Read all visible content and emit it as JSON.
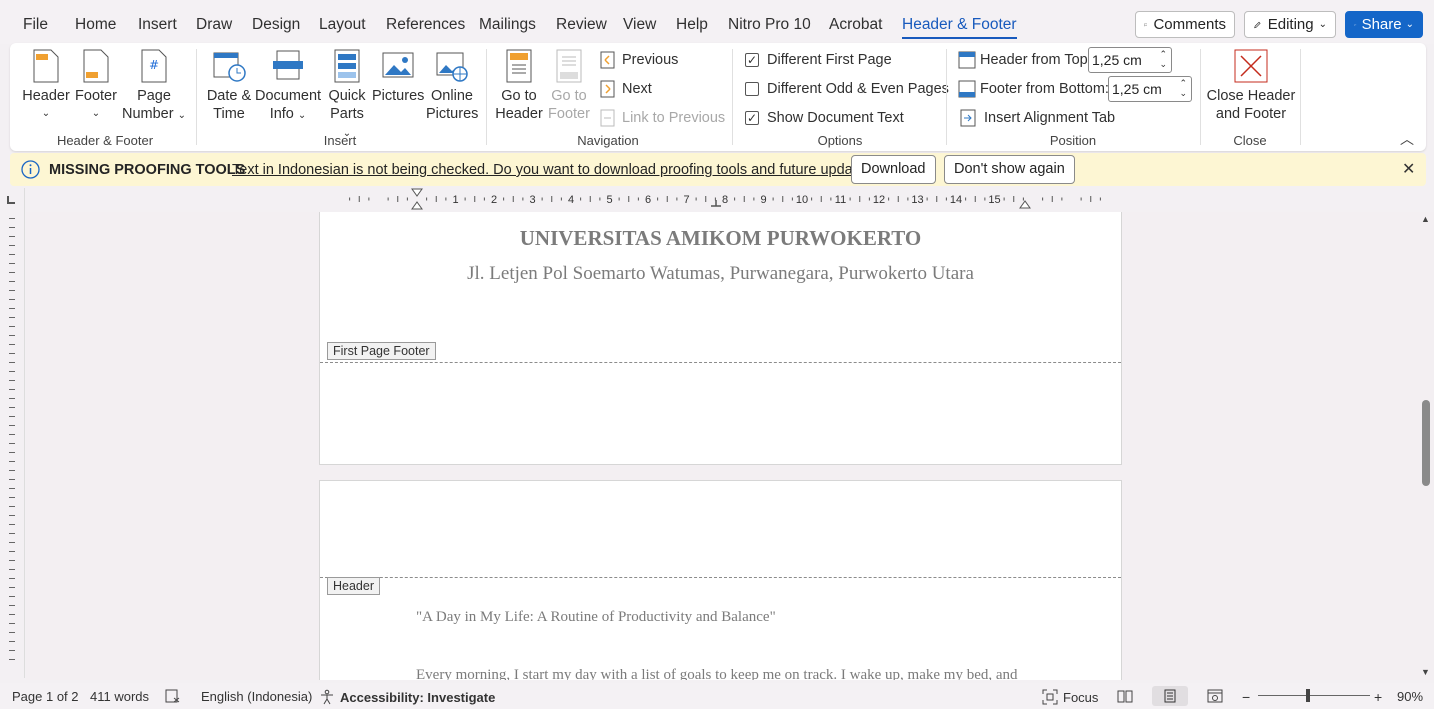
{
  "menu": {
    "tabs": [
      "File",
      "Home",
      "Insert",
      "Draw",
      "Design",
      "Layout",
      "References",
      "Mailings",
      "Review",
      "View",
      "Help",
      "Nitro Pro 10",
      "Acrobat",
      "Header & Footer"
    ],
    "active_tab": "Header & Footer",
    "comments_label": "Comments",
    "editing_label": "Editing",
    "share_label": "Share"
  },
  "ribbon": {
    "groups": {
      "header_footer": {
        "label": "Header & Footer",
        "header": "Header",
        "footer": "Footer",
        "page_number_line1": "Page",
        "page_number_line2": "Number"
      },
      "insert": {
        "label": "Insert",
        "date_time_line1": "Date &",
        "date_time_line2": "Time",
        "doc_info_line1": "Document",
        "doc_info_line2": "Info",
        "quick_parts_line1": "Quick",
        "quick_parts_line2": "Parts",
        "pictures": "Pictures",
        "online_pictures_line1": "Online",
        "online_pictures_line2": "Pictures"
      },
      "navigation": {
        "label": "Navigation",
        "go_to_header_line1": "Go to",
        "go_to_header_line2": "Header",
        "go_to_footer_line1": "Go to",
        "go_to_footer_line2": "Footer",
        "previous": "Previous",
        "next": "Next",
        "link_to_previous": "Link to Previous"
      },
      "options": {
        "label": "Options",
        "different_first_page": "Different First Page",
        "different_first_page_checked": true,
        "different_odd_even": "Different Odd & Even Pages",
        "different_odd_even_checked": false,
        "show_document_text": "Show Document Text",
        "show_document_text_checked": true
      },
      "position": {
        "label": "Position",
        "header_from_top_label": "Header from Top:",
        "header_from_top_value": "1,25 cm",
        "footer_from_bottom_label": "Footer from Bottom:",
        "footer_from_bottom_value": "1,25 cm",
        "insert_alignment_tab": "Insert Alignment Tab"
      },
      "close": {
        "label": "Close",
        "close_line1": "Close Header",
        "close_line2": "and Footer"
      }
    }
  },
  "infobar": {
    "title": "MISSING PROOFING TOOLS",
    "message": "Text in Indonesian is not being checked. Do you want to download proofing tools and future updates?",
    "download": "Download",
    "dont_show": "Don't show again"
  },
  "ruler": {
    "numbers": [
      "1",
      "2",
      "3",
      "4",
      "5",
      "6",
      "7",
      "8",
      "9",
      "10",
      "11",
      "12",
      "13",
      "14",
      "15"
    ]
  },
  "document": {
    "page1": {
      "university": "UNIVERSITAS AMIKOM PURWOKERTO",
      "address": "Jl. Letjen Pol Soemarto Watumas, Purwanegara, Purwokerto Utara",
      "footer_tag": "First Page Footer"
    },
    "page2": {
      "header_tag": "Header",
      "title": "\"A Day in My Life: A Routine of Productivity and Balance\"",
      "paragraph": "Every morning, I start my day with a list of goals to keep me on track. I wake up, make my bed, and"
    }
  },
  "status": {
    "page": "Page 1 of 2",
    "words": "411 words",
    "language": "English (Indonesia)",
    "accessibility": "Accessibility: Investigate",
    "focus": "Focus",
    "zoom_minus": "−",
    "zoom_plus": "+",
    "zoom": "90%"
  }
}
